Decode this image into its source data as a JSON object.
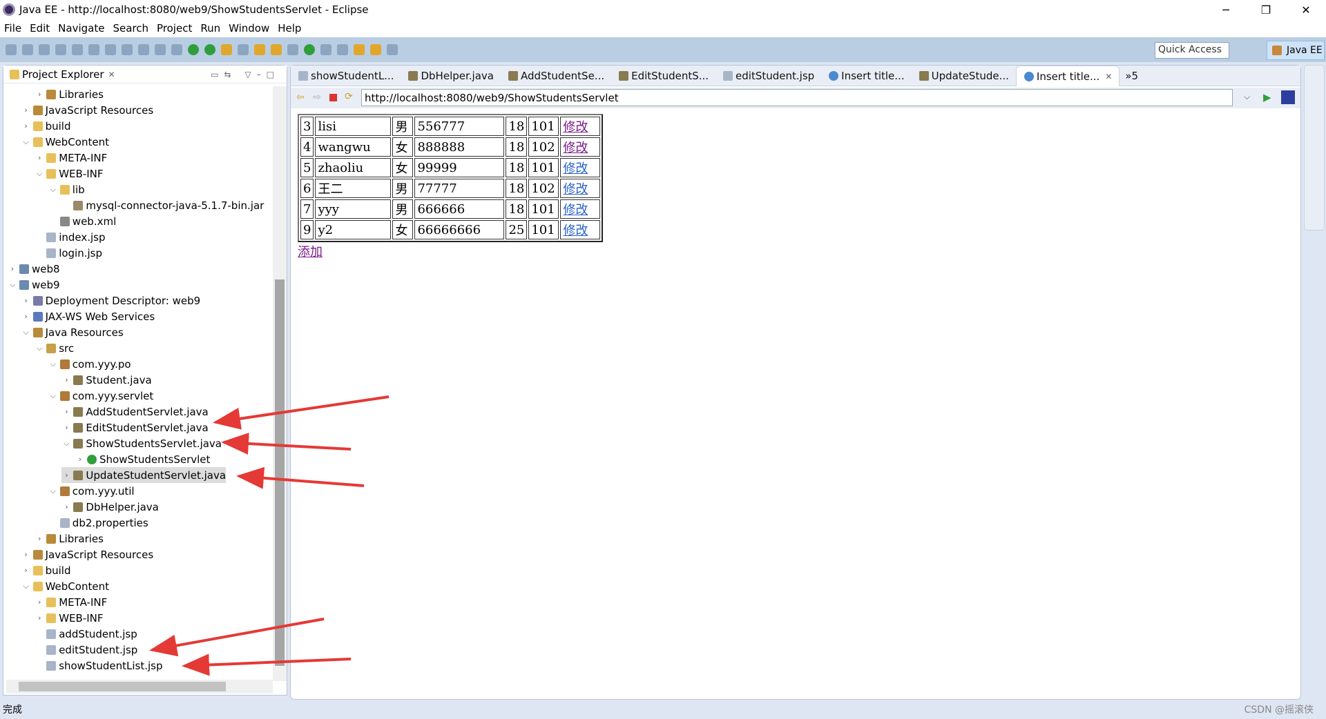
{
  "window": {
    "title": "Java EE - http://localhost:8080/web9/ShowStudentsServlet - Eclipse",
    "minimize": "─",
    "restore": "❐",
    "close": "✕"
  },
  "menu": [
    "File",
    "Edit",
    "Navigate",
    "Search",
    "Project",
    "Run",
    "Window",
    "Help"
  ],
  "toolbar": {
    "quick_access": "Quick Access",
    "perspective": "Java EE"
  },
  "explorer": {
    "title": "Project Explorer",
    "items": [
      {
        "label": "Libraries",
        "level": 2,
        "state": "collapsed",
        "icon": "library"
      },
      {
        "label": "JavaScript Resources",
        "level": 1,
        "state": "collapsed",
        "icon": "library"
      },
      {
        "label": "build",
        "level": 1,
        "state": "collapsed",
        "icon": "folder"
      },
      {
        "label": "WebContent",
        "level": 1,
        "state": "expanded",
        "icon": "folder"
      },
      {
        "label": "META-INF",
        "level": 2,
        "state": "collapsed",
        "icon": "folder"
      },
      {
        "label": "WEB-INF",
        "level": 2,
        "state": "expanded",
        "icon": "folder"
      },
      {
        "label": "lib",
        "level": 3,
        "state": "expanded",
        "icon": "folder"
      },
      {
        "label": "mysql-connector-java-5.1.7-bin.jar",
        "level": 4,
        "state": "leaf",
        "icon": "jar"
      },
      {
        "label": "web.xml",
        "level": 3,
        "state": "leaf",
        "icon": "xml"
      },
      {
        "label": "index.jsp",
        "level": 2,
        "state": "leaf",
        "icon": "file"
      },
      {
        "label": "login.jsp",
        "level": 2,
        "state": "leaf",
        "icon": "file"
      },
      {
        "label": "web8",
        "level": 0,
        "state": "collapsed",
        "icon": "project"
      },
      {
        "label": "web9",
        "level": 0,
        "state": "expanded",
        "icon": "project"
      },
      {
        "label": "Deployment Descriptor: web9",
        "level": 1,
        "state": "collapsed",
        "icon": "descriptor"
      },
      {
        "label": "JAX-WS Web Services",
        "level": 1,
        "state": "collapsed",
        "icon": "webservice"
      },
      {
        "label": "Java Resources",
        "level": 1,
        "state": "expanded",
        "icon": "library"
      },
      {
        "label": "src",
        "level": 2,
        "state": "expanded",
        "icon": "source-folder"
      },
      {
        "label": "com.yyy.po",
        "level": 3,
        "state": "expanded",
        "icon": "package"
      },
      {
        "label": "Student.java",
        "level": 4,
        "state": "collapsed",
        "icon": "java-file"
      },
      {
        "label": "com.yyy.servlet",
        "level": 3,
        "state": "expanded",
        "icon": "package"
      },
      {
        "label": "AddStudentServlet.java",
        "level": 4,
        "state": "collapsed",
        "icon": "java-file"
      },
      {
        "label": "EditStudentServlet.java",
        "level": 4,
        "state": "collapsed",
        "icon": "java-file"
      },
      {
        "label": "ShowStudentsServlet.java",
        "level": 4,
        "state": "expanded",
        "icon": "java-file"
      },
      {
        "label": "ShowStudentsServlet",
        "level": 5,
        "state": "collapsed",
        "icon": "class"
      },
      {
        "label": "UpdateStudentServlet.java",
        "level": 4,
        "state": "collapsed",
        "icon": "java-file",
        "selected": true
      },
      {
        "label": "com.yyy.util",
        "level": 3,
        "state": "expanded",
        "icon": "package"
      },
      {
        "label": "DbHelper.java",
        "level": 4,
        "state": "collapsed",
        "icon": "java-file"
      },
      {
        "label": "db2.properties",
        "level": 3,
        "state": "leaf",
        "icon": "file"
      },
      {
        "label": "Libraries",
        "level": 2,
        "state": "collapsed",
        "icon": "library"
      },
      {
        "label": "JavaScript Resources",
        "level": 1,
        "state": "collapsed",
        "icon": "library"
      },
      {
        "label": "build",
        "level": 1,
        "state": "collapsed",
        "icon": "folder"
      },
      {
        "label": "WebContent",
        "level": 1,
        "state": "expanded",
        "icon": "folder"
      },
      {
        "label": "META-INF",
        "level": 2,
        "state": "collapsed",
        "icon": "folder"
      },
      {
        "label": "WEB-INF",
        "level": 2,
        "state": "collapsed",
        "icon": "folder"
      },
      {
        "label": "addStudent.jsp",
        "level": 2,
        "state": "leaf",
        "icon": "file"
      },
      {
        "label": "editStudent.jsp",
        "level": 2,
        "state": "leaf",
        "icon": "file"
      },
      {
        "label": "showStudentList.jsp",
        "level": 2,
        "state": "leaf",
        "icon": "file"
      }
    ]
  },
  "editor": {
    "tabs": [
      {
        "label": "showStudentL...",
        "icon": "jsp"
      },
      {
        "label": "DbHelper.java",
        "icon": "java"
      },
      {
        "label": "AddStudentSe...",
        "icon": "java"
      },
      {
        "label": "EditStudentS...",
        "icon": "java"
      },
      {
        "label": "editStudent.jsp",
        "icon": "jsp"
      },
      {
        "label": "Insert title...",
        "icon": "globe"
      },
      {
        "label": "UpdateStude...",
        "icon": "java"
      },
      {
        "label": "Insert title...",
        "icon": "globe",
        "active": true
      }
    ],
    "overflow": "»5",
    "url": "http://localhost:8080/web9/ShowStudentsServlet"
  },
  "students": {
    "rows": [
      {
        "id": "3",
        "name": "lisi",
        "sex": "男",
        "pwd": "556777",
        "age": "18",
        "cls": "101",
        "edit": "修改",
        "visited": true
      },
      {
        "id": "4",
        "name": "wangwu",
        "sex": "女",
        "pwd": "888888",
        "age": "18",
        "cls": "102",
        "edit": "修改",
        "visited": true
      },
      {
        "id": "5",
        "name": "zhaoliu",
        "sex": "女",
        "pwd": "99999",
        "age": "18",
        "cls": "101",
        "edit": "修改",
        "visited": false
      },
      {
        "id": "6",
        "name": "王二",
        "sex": "男",
        "pwd": "77777",
        "age": "18",
        "cls": "102",
        "edit": "修改",
        "visited": false
      },
      {
        "id": "7",
        "name": "yyy",
        "sex": "男",
        "pwd": "666666",
        "age": "18",
        "cls": "101",
        "edit": "修改",
        "visited": false
      },
      {
        "id": "9",
        "name": "y2",
        "sex": "女",
        "pwd": "66666666",
        "age": "25",
        "cls": "101",
        "edit": "修改",
        "visited": false
      }
    ],
    "add": "添加"
  },
  "status": {
    "text": "完成",
    "watermark": "CSDN @摇滚侠"
  },
  "colors": {
    "arrow": "#e53935",
    "visited_link": "#7a1a8a",
    "link": "#2762c9"
  }
}
